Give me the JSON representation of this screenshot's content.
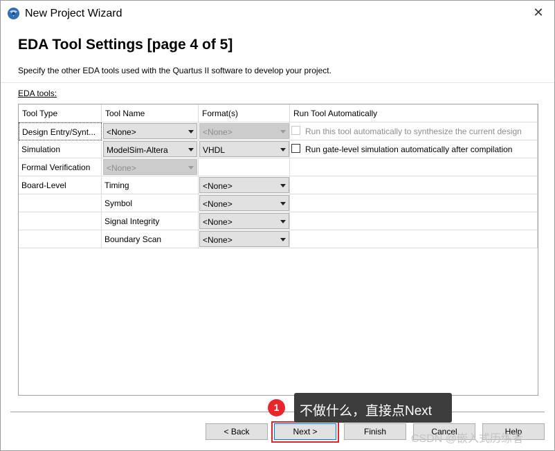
{
  "window": {
    "title": "New Project Wizard"
  },
  "page": {
    "heading": "EDA Tool Settings [page 4 of 5]",
    "description": "Specify the other EDA tools used with the Quartus II software to develop your project.",
    "eda_label": "EDA tools:"
  },
  "table": {
    "headers": [
      "Tool Type",
      "Tool Name",
      "Format(s)",
      "Run Tool Automatically"
    ],
    "rows": [
      {
        "tool_type": "Design Entry/Synt...",
        "tool_name": "<None>",
        "format": "<None>",
        "run_label": "Run this tool automatically to synthesize the current design"
      },
      {
        "tool_type": "Simulation",
        "tool_name": "ModelSim-Altera",
        "format": "VHDL",
        "run_label": "Run gate-level simulation automatically after compilation"
      },
      {
        "tool_type": "Formal Verification",
        "tool_name": "<None>"
      },
      {
        "tool_type": "Board-Level",
        "tool_name": "Timing",
        "format": "<None>"
      },
      {
        "tool_type": "",
        "tool_name": "Symbol",
        "format": "<None>"
      },
      {
        "tool_type": "",
        "tool_name": "Signal Integrity",
        "format": "<None>"
      },
      {
        "tool_type": "",
        "tool_name": "Boundary Scan",
        "format": "<None>"
      }
    ]
  },
  "buttons": {
    "back": "< Back",
    "next": "Next >",
    "finish": "Finish",
    "cancel": "Cancel",
    "help": "Help"
  },
  "annotation": {
    "badge": "1",
    "callout": "不做什么，直接点Next",
    "watermark": "CSDN @嵌入式历练者"
  }
}
